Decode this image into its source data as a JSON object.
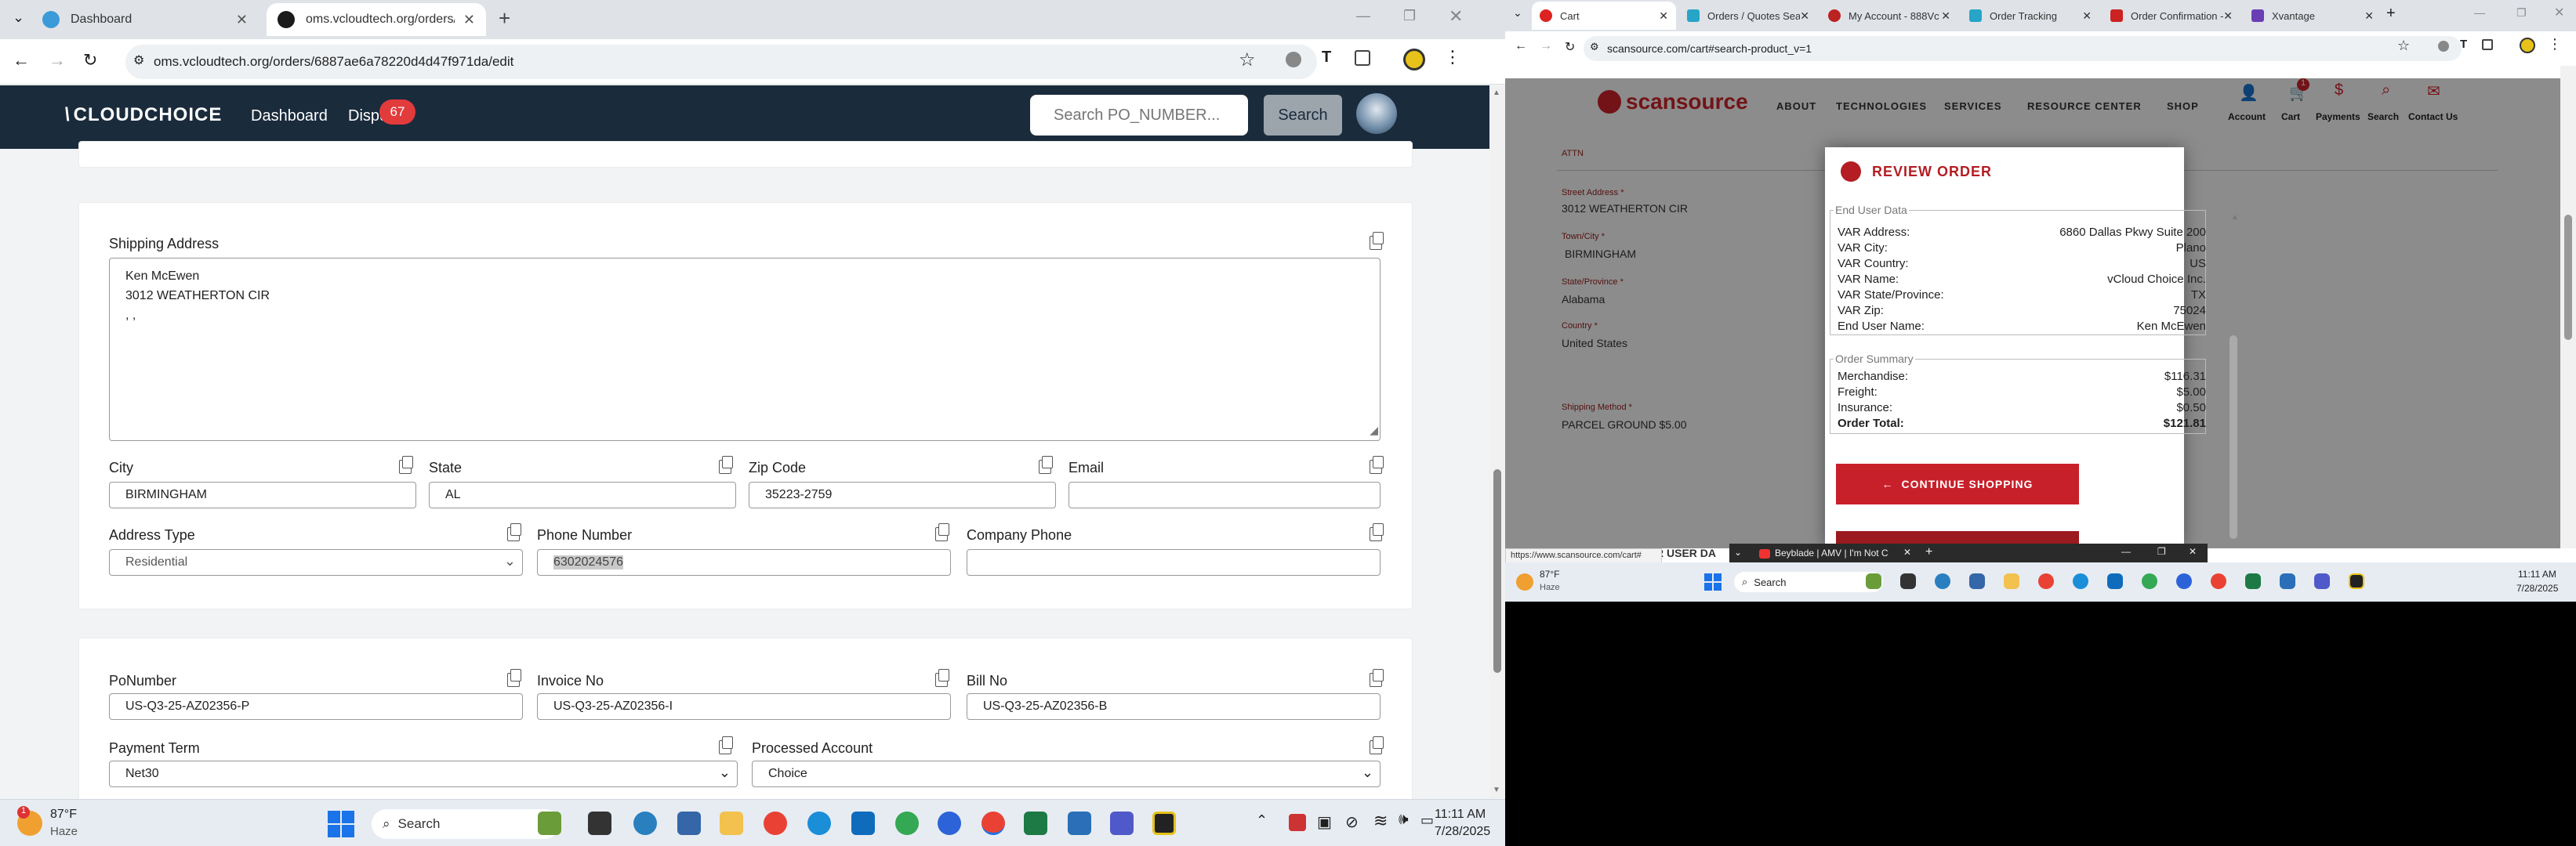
{
  "left": {
    "tabs": [
      {
        "title": "Dashboard"
      },
      {
        "title": "oms.vcloudtech.org/orders/68..."
      }
    ],
    "url": "oms.vcloudtech.org/orders/6887ae6a78220d4d47f971da/edit",
    "nav": {
      "logo": "CLOUDCHOICE",
      "links": [
        "Dashboard",
        "Dispu"
      ],
      "badge": "67",
      "search_placeholder": "Search PO_NUMBER...",
      "search_button": "Search"
    },
    "shipping": {
      "label": "Shipping Address",
      "lines": [
        "Ken McEwen",
        "3012 WEATHERTON CIR",
        ", ,"
      ],
      "city_label": "City",
      "city": "BIRMINGHAM",
      "state_label": "State",
      "state": "AL",
      "zip_label": "Zip Code",
      "zip": "35223-2759",
      "email_label": "Email",
      "email": "",
      "address_type_label": "Address Type",
      "address_type": "Residential",
      "phone_label": "Phone Number",
      "phone": "6302024576",
      "company_phone_label": "Company Phone",
      "company_phone": ""
    },
    "order": {
      "po_label": "PoNumber",
      "po": "US-Q3-25-AZ02356-P",
      "invoice_label": "Invoice No",
      "invoice": "US-Q3-25-AZ02356-I",
      "bill_label": "Bill No",
      "bill": "US-Q3-25-AZ02356-B",
      "payment_term_label": "Payment Term",
      "payment_term": "Net30",
      "processed_account_label": "Processed Account",
      "processed_account": "Choice"
    },
    "taskbar": {
      "weather_temp": "87°F",
      "weather_desc": "Haze",
      "search": "Search",
      "time": "11:11 AM",
      "date": "7/28/2025"
    }
  },
  "right": {
    "tabs": [
      {
        "title": "Cart"
      },
      {
        "title": "Orders / Quotes Sear"
      },
      {
        "title": "My Account - 888Vc"
      },
      {
        "title": "Order Tracking"
      },
      {
        "title": "Order Confirmation - I"
      },
      {
        "title": "Xvantage"
      }
    ],
    "url": "scansource.com/cart#search-product_v=1",
    "logo": "scansource",
    "menu": [
      "ABOUT",
      "TECHNOLOGIES",
      "SERVICES",
      "RESOURCE CENTER",
      "SHOP"
    ],
    "icons": [
      "Account",
      "Cart",
      "Payments",
      "Search",
      "Contact Us"
    ],
    "cart_badge": "1",
    "form": {
      "attn_label": "ATTN",
      "street_label": "Street Address *",
      "street": "3012 WEATHERTON CIR",
      "town_label": "Town/City *",
      "town": "BIRMINGHAM",
      "state_label": "State/Province *",
      "state": "Alabama",
      "country_label": "Country *",
      "country": "United States",
      "ship_label": "Shipping Method *",
      "ship": "PARCEL GROUND $5.00",
      "end_user_cut": "R USER DA"
    },
    "modal": {
      "title": "REVIEW ORDER",
      "end_user_legend": "End User Data",
      "end_user_rows": [
        {
          "k": "VAR Address:",
          "v": "6860 Dallas Pkwy Suite 200"
        },
        {
          "k": "VAR City:",
          "v": "Plano"
        },
        {
          "k": "VAR Country:",
          "v": "US"
        },
        {
          "k": "VAR Name:",
          "v": "vCloud Choice Inc."
        },
        {
          "k": "VAR State/Province:",
          "v": "TX"
        },
        {
          "k": "VAR Zip:",
          "v": "75024"
        },
        {
          "k": "End User Name:",
          "v": "Ken McEwen"
        }
      ],
      "summary_legend": "Order Summary",
      "summary_rows": [
        {
          "k": "Merchandise:",
          "v": "$116.31"
        },
        {
          "k": "Freight:",
          "v": "$5.00"
        },
        {
          "k": "Insurance:",
          "v": "$0.50"
        },
        {
          "k": "Order Total:",
          "v": "$121.81"
        }
      ],
      "continue_button": "CONTINUE SHOPPING"
    },
    "status_url": "https://www.scansource.com/cart#",
    "media_title": "Beyblade | AMV | I'm Not C",
    "taskbar": {
      "weather_temp": "87°F",
      "weather_desc": "Haze",
      "search": "Search",
      "time": "11:11 AM",
      "date": "7/28/2025"
    }
  }
}
